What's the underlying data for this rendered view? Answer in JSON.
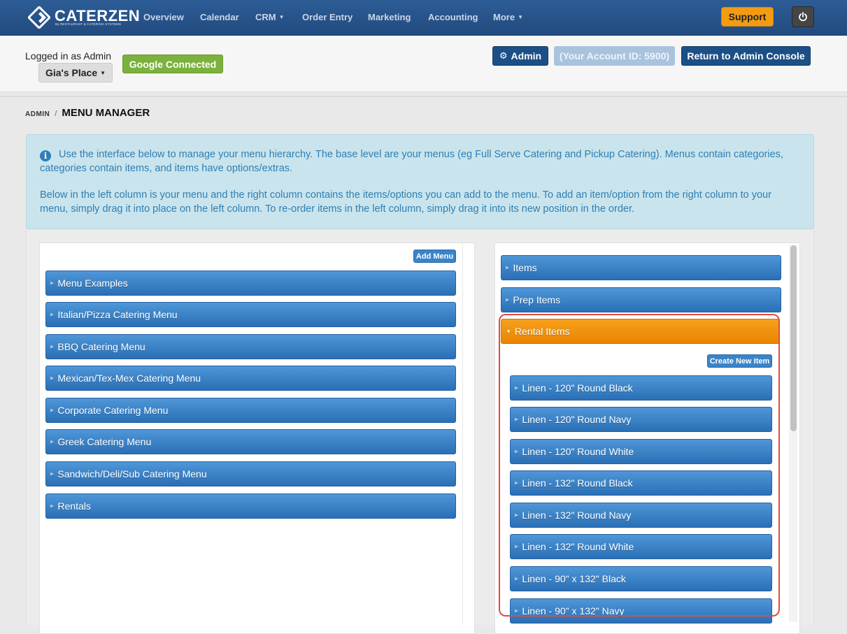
{
  "navbar": {
    "logo_text": "CATERZEN",
    "logo_sub": "By RESTAURANT & CATERING SYSTEMS",
    "items": [
      {
        "label": "Overview"
      },
      {
        "label": "Calendar"
      },
      {
        "label": "CRM"
      },
      {
        "label": "Order Entry"
      },
      {
        "label": "Marketing"
      },
      {
        "label": "Accounting"
      },
      {
        "label": "More"
      }
    ],
    "support_label": "Support"
  },
  "admin_bar": {
    "logged_in_text": "Logged in as Admin",
    "place_label": "Gia's Place",
    "google_label": "Google Connected",
    "admin_label": "Admin",
    "account_id_text": "(Your Account ID: 5900)",
    "return_label": "Return to Admin Console"
  },
  "breadcrumb": {
    "root": "ADMIN",
    "separator": "/",
    "current": "MENU MANAGER"
  },
  "info": {
    "paragraph1": "Use the interface below to manage your menu hierarchy. The base level are your menus (eg Full Serve Catering and Pickup Catering). Menus contain categories, categories contain items, and items have options/extras.",
    "paragraph2": "Below in the left column is your menu and the right column contains the items/options you can add to the menu. To add an item/option from the right column to your menu, simply drag it into place on the left column. To re-order items in the left column, simply drag it into its new position in the order."
  },
  "left_column": {
    "add_menu_label": "Add Menu",
    "menus": [
      {
        "label": "Menu Examples"
      },
      {
        "label": "Italian/Pizza Catering Menu"
      },
      {
        "label": "BBQ Catering Menu"
      },
      {
        "label": "Mexican/Tex-Mex Catering Menu"
      },
      {
        "label": "Corporate Catering Menu"
      },
      {
        "label": "Greek Catering Menu"
      },
      {
        "label": "Sandwich/Deli/Sub Catering Menu"
      },
      {
        "label": "Rentals"
      }
    ]
  },
  "right_column": {
    "groups": [
      {
        "label": "Items"
      },
      {
        "label": "Prep Items"
      },
      {
        "label": "Rental Items"
      }
    ],
    "create_item_label": "Create New Item",
    "rental_items": [
      {
        "label": "Linen - 120\" Round Black"
      },
      {
        "label": "Linen - 120\" Round Navy"
      },
      {
        "label": "Linen - 120\" Round White"
      },
      {
        "label": "Linen - 132\" Round Black"
      },
      {
        "label": "Linen - 132\" Round Navy"
      },
      {
        "label": "Linen - 132\" Round White"
      },
      {
        "label": "Linen - 90\" x 132\" Black"
      },
      {
        "label": "Linen - 90\" x 132\" Navy"
      }
    ]
  },
  "colors": {
    "navbar": "#224b80",
    "support": "#f39c12",
    "google": "#7bb13c",
    "bar_blue": "#2a6fb6",
    "bar_orange": "#e98500",
    "highlight": "#e24b3b",
    "info_bg": "#c9e4ec"
  }
}
